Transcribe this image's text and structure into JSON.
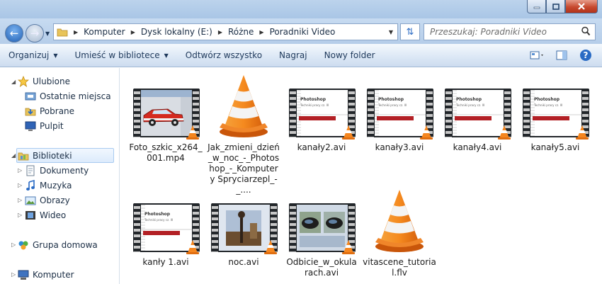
{
  "address": {
    "crumbs": [
      "Komputer",
      "Dysk lokalny (E:)",
      "Różne",
      "Poradniki Video"
    ]
  },
  "search": {
    "placeholder": "Przeszukaj: Poradniki Video"
  },
  "toolbar": {
    "organize": "Organizuj",
    "library": "Umieść w bibliotece",
    "play_all": "Odtwórz wszystko",
    "burn": "Nagraj",
    "new_folder": "Nowy folder"
  },
  "nav": {
    "favorites": {
      "label": "Ulubione",
      "items": [
        "Ostatnie miejsca",
        "Pobrane",
        "Pulpit"
      ]
    },
    "libraries": {
      "label": "Biblioteki",
      "items": [
        "Dokumenty",
        "Muzyka",
        "Obrazy",
        "Wideo"
      ]
    },
    "homegroup": "Grupa domowa",
    "computer": "Komputer"
  },
  "files": [
    {
      "name": "Foto_szkic_x264_001.mp4",
      "thumb": "car"
    },
    {
      "name": "Jak_zmieni_dzień_w_noc_-_Photoshop_-_Komputery Spryciarzepl_-_....",
      "thumb": "vlc"
    },
    {
      "name": "kanały2.avi",
      "thumb": "ps"
    },
    {
      "name": "kanały3.avi",
      "thumb": "ps"
    },
    {
      "name": "kanały4.avi",
      "thumb": "ps"
    },
    {
      "name": "kanały5.avi",
      "thumb": "ps"
    },
    {
      "name": "kanły 1.avi",
      "thumb": "ps"
    },
    {
      "name": "noc.avi",
      "thumb": "night"
    },
    {
      "name": "Odbicie_w_okularach.avi",
      "thumb": "glasses"
    },
    {
      "name": "vitascene_tutorial.flv",
      "thumb": "vlc"
    }
  ],
  "thumb_texts": {
    "ps_title": "Photoshop",
    "ps_sub": "Techniki pracy cz. III"
  },
  "colors": {
    "accent": "#2a6bc4",
    "vlc_orange": "#f5861f"
  }
}
